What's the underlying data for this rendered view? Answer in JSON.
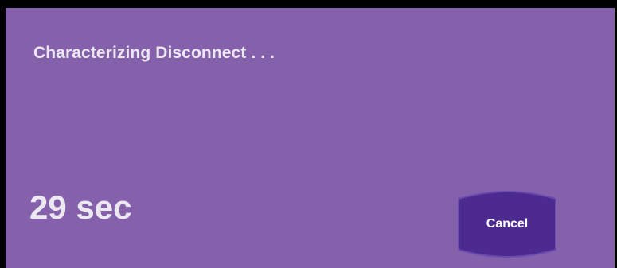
{
  "dialog": {
    "message": "Characterizing Disconnect . . .",
    "remaining_time": "29 sec",
    "cancel_label": "Cancel"
  },
  "colors": {
    "background": "#8560ab",
    "text": "#ece8f2",
    "button": "#4c2a8f",
    "button_border": "#6b4bb0",
    "frame": "#000000"
  }
}
